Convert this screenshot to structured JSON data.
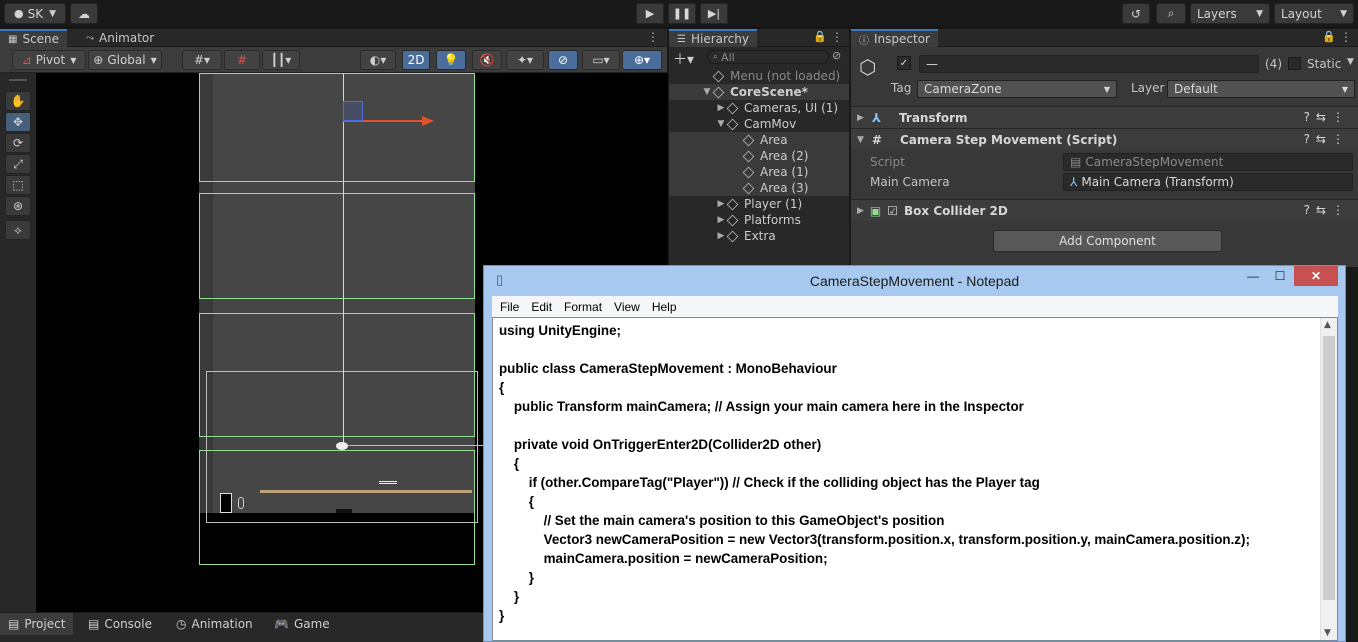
{
  "toolbar": {
    "account": "SK",
    "layers": "Layers",
    "layout": "Layout"
  },
  "scene_panel": {
    "tabs": [
      "Scene",
      "Animator"
    ],
    "pivot": "Pivot",
    "global": "Global",
    "mode_2d": "2D"
  },
  "hierarchy": {
    "title": "Hierarchy",
    "search_placeholder": "All",
    "rows": [
      {
        "label": "Menu (not loaded)"
      },
      {
        "label": "CoreScene*"
      },
      {
        "label": "Cameras, UI (1)"
      },
      {
        "label": "CamMov"
      },
      {
        "label": "Area"
      },
      {
        "label": "Area (2)"
      },
      {
        "label": "Area (1)"
      },
      {
        "label": "Area (3)"
      },
      {
        "label": "Player (1)"
      },
      {
        "label": "Platforms"
      },
      {
        "label": "Extra"
      }
    ]
  },
  "inspector": {
    "title": "Inspector",
    "object_name": "—",
    "count": "(4)",
    "static_label": "Static",
    "tag_label": "Tag",
    "tag_value": "CameraZone",
    "layer_label": "Layer",
    "layer_value": "Default",
    "components": {
      "transform": "Transform",
      "script_comp": "Camera Step Movement (Script)",
      "collider": "Box Collider 2D"
    },
    "script_label": "Script",
    "script_value": "CameraStepMovement",
    "main_camera_label": "Main Camera",
    "main_camera_value": "Main Camera (Transform)",
    "add_component": "Add Component"
  },
  "bottom_tabs": [
    "Project",
    "Console",
    "Animation",
    "Game"
  ],
  "notepad": {
    "title": "CameraStepMovement - Notepad",
    "menu": [
      "File",
      "Edit",
      "Format",
      "View",
      "Help"
    ],
    "code": "using UnityEngine;\n\npublic class CameraStepMovement : MonoBehaviour\n{\n    public Transform mainCamera; // Assign your main camera here in the Inspector\n\n    private void OnTriggerEnter2D(Collider2D other)\n    {\n        if (other.CompareTag(\"Player\")) // Check if the colliding object has the Player tag\n        {\n            // Set the main camera's position to this GameObject's position\n            Vector3 newCameraPosition = new Vector3(transform.position.x, transform.position.y, mainCamera.position.z);\n            mainCamera.position = newCameraPosition;\n        }\n    }\n}"
  }
}
